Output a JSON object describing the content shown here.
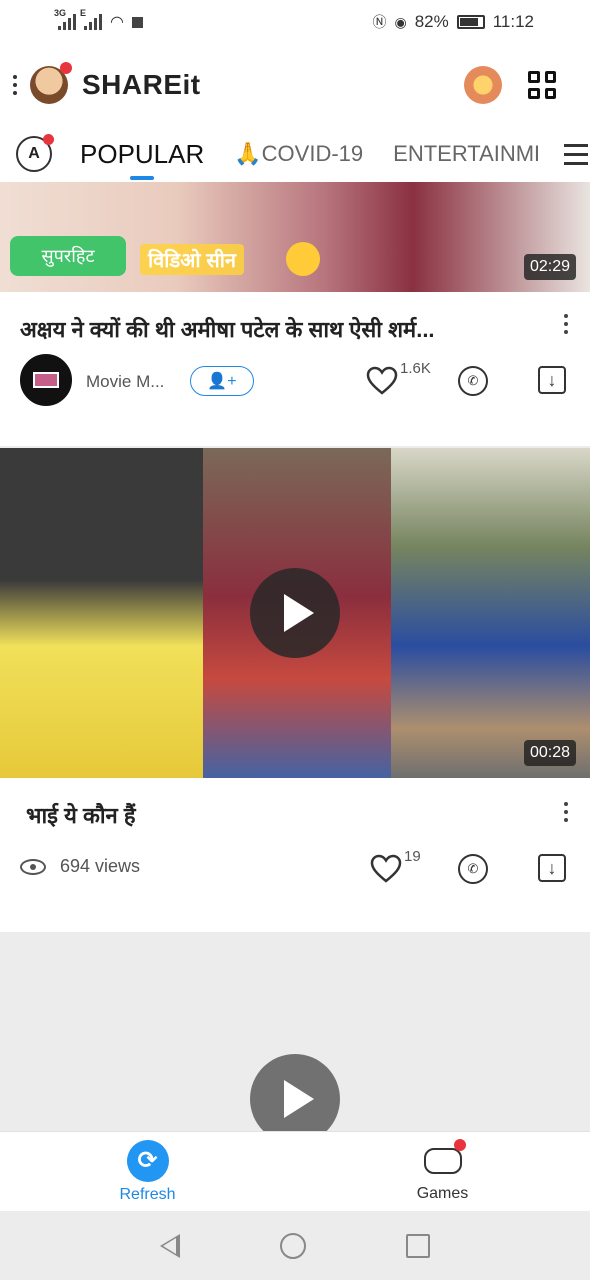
{
  "status": {
    "net1": "3G",
    "net2": "E",
    "battery": "82%",
    "time": "11:12"
  },
  "app": {
    "name": "SHAREit"
  },
  "tabs": {
    "lang": "A",
    "items": [
      "POPULAR",
      "🙏COVID-19",
      "ENTERTAINME"
    ]
  },
  "posts": [
    {
      "thumb_text": [
        "सुपरहिट",
        "विडिओ सीन"
      ],
      "duration": "02:29",
      "title": "अक्षय ने क्यों की थी अमीषा पटेल के साथ ऐसी शर्म...",
      "channel": "Movie M...",
      "follow": "👤+",
      "likes": "1.6K"
    },
    {
      "duration": "00:28",
      "title": "भाई ये कौन हैं",
      "views": "694 views",
      "likes": "19"
    }
  ],
  "bottom_nav": {
    "refresh": "Refresh",
    "games": "Games"
  },
  "colors": {
    "accent": "#1e88e5",
    "badge": "#e8343c"
  }
}
